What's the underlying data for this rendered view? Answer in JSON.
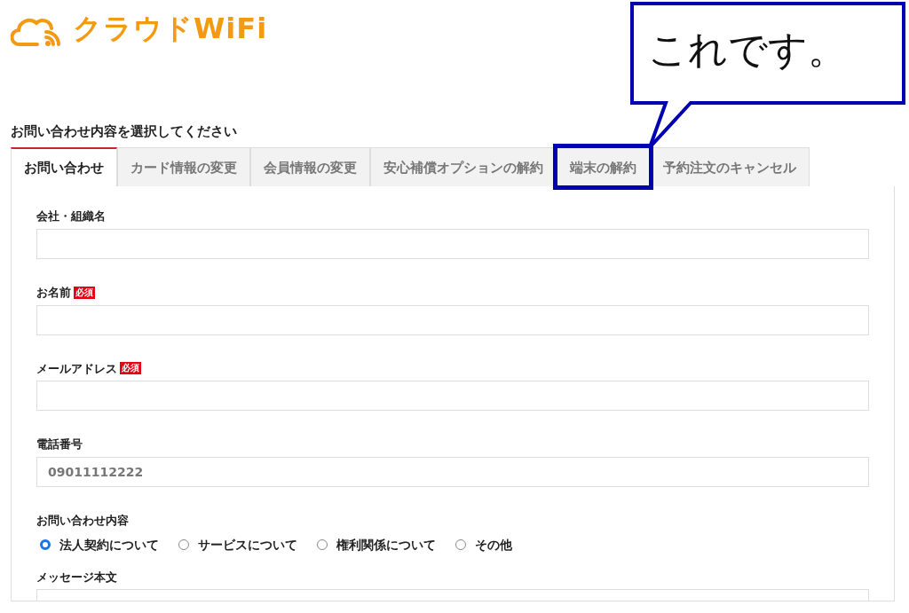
{
  "logo": {
    "text": "クラウドWiFi"
  },
  "heading": "お問い合わせ内容を選択してください",
  "tabs": [
    {
      "label": "お問い合わせ",
      "selected": true,
      "highlighted": false
    },
    {
      "label": "カード情報の変更",
      "selected": false,
      "highlighted": false
    },
    {
      "label": "会員情報の変更",
      "selected": false,
      "highlighted": false
    },
    {
      "label": "安心補償オプションの解約",
      "selected": false,
      "highlighted": false
    },
    {
      "label": "端末の解約",
      "selected": false,
      "highlighted": true
    },
    {
      "label": "予約注文のキャンセル",
      "selected": false,
      "highlighted": false
    }
  ],
  "form": {
    "fields": [
      {
        "kind": "text",
        "label": "会社・組織名",
        "required": false
      },
      {
        "kind": "text",
        "label": "お名前",
        "required": true,
        "badge": "必須"
      },
      {
        "kind": "text",
        "label": "メールアドレス",
        "required": true,
        "badge": "必須"
      },
      {
        "kind": "text",
        "label": "電話番号",
        "required": false,
        "placeholder": "09011112222"
      },
      {
        "kind": "radio",
        "label": "お問い合わせ内容",
        "required": false,
        "options": [
          {
            "label": "法人契約について",
            "selected": true
          },
          {
            "label": "サービスについて",
            "selected": false
          },
          {
            "label": "権利関係について",
            "selected": false
          },
          {
            "label": "その他",
            "selected": false
          }
        ]
      },
      {
        "kind": "textarea",
        "label": "メッセージ本文",
        "required": false
      }
    ]
  },
  "callout": {
    "text": "これです。"
  }
}
